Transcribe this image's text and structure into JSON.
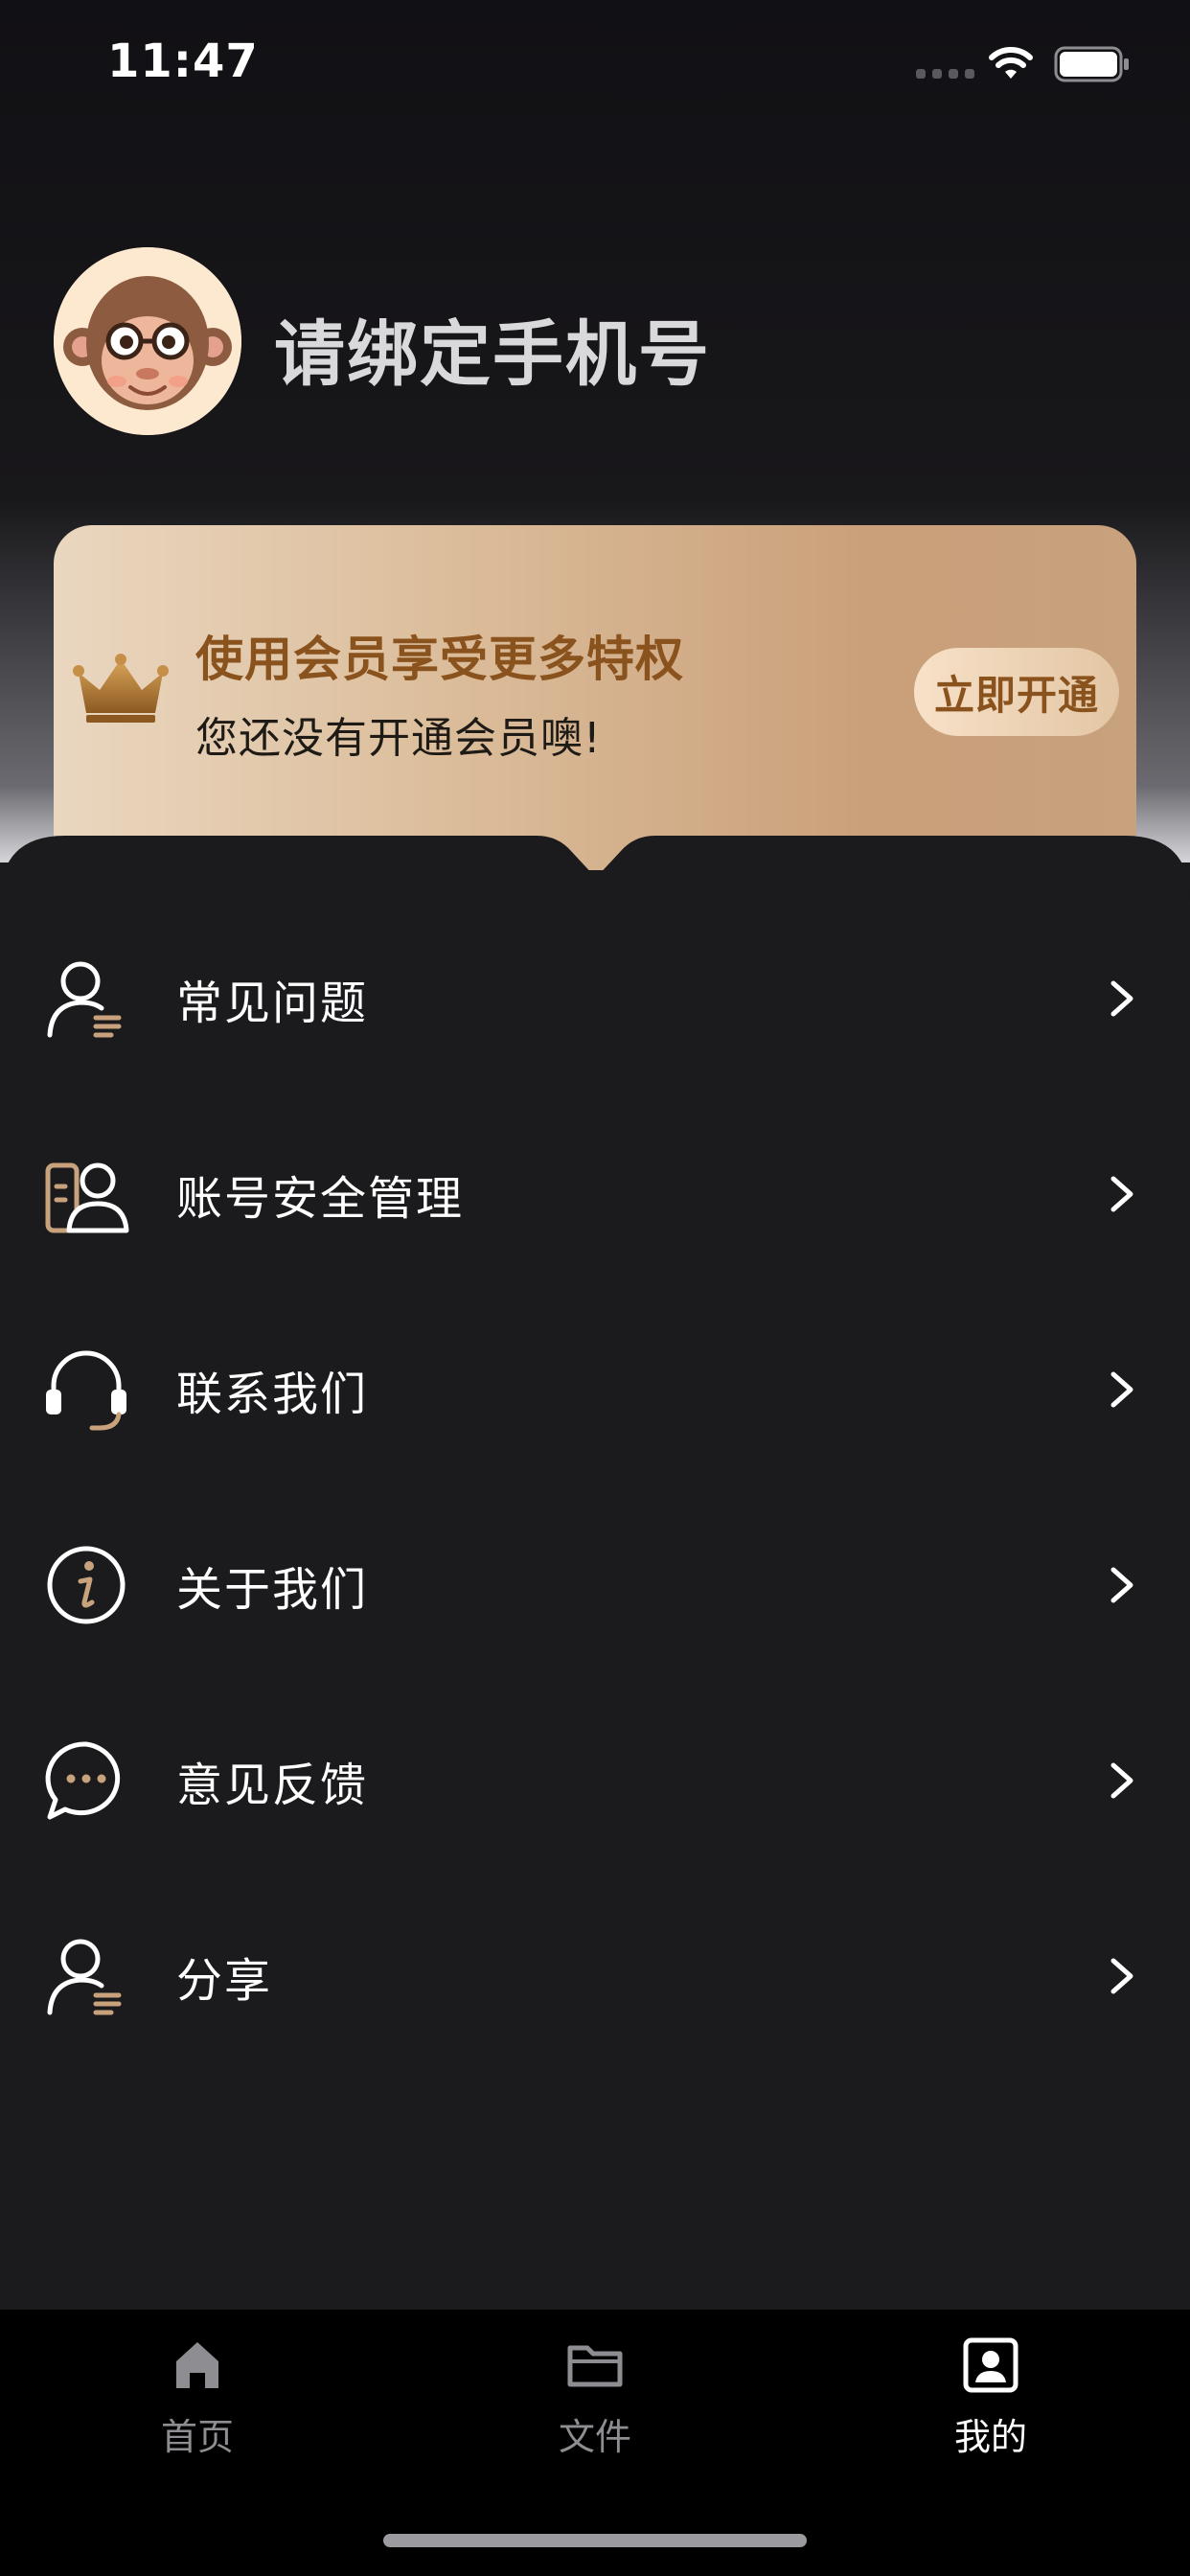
{
  "status_bar": {
    "time": "11:47",
    "icons": [
      "cellular-signal-icon",
      "wifi-icon",
      "battery-icon"
    ]
  },
  "profile": {
    "avatar_icon": "monkey-avatar-icon",
    "name": "请绑定手机号"
  },
  "vip_card": {
    "icon": "crown-icon",
    "title": "使用会员享受更多特权",
    "subtitle": "您还没有开通会员噢!",
    "button_label": "立即开通"
  },
  "menu": {
    "items": [
      {
        "label": "常见问题",
        "icon": "user-list-icon"
      },
      {
        "label": "账号安全管理",
        "icon": "account-security-icon"
      },
      {
        "label": "联系我们",
        "icon": "headset-icon"
      },
      {
        "label": "关于我们",
        "icon": "info-icon"
      },
      {
        "label": "意见反馈",
        "icon": "chat-bubble-icon"
      },
      {
        "label": "分享",
        "icon": "user-list-icon"
      }
    ]
  },
  "tab_bar": {
    "tabs": [
      {
        "label": "首页",
        "icon": "home-icon",
        "active": false
      },
      {
        "label": "文件",
        "icon": "folder-icon",
        "active": false
      },
      {
        "label": "我的",
        "icon": "profile-card-icon",
        "active": true
      }
    ]
  },
  "colors": {
    "background": "#141316",
    "sheet": "#1b1b1d",
    "accent_gold": "#8a531e",
    "icon_gold": "#c8a27c"
  }
}
